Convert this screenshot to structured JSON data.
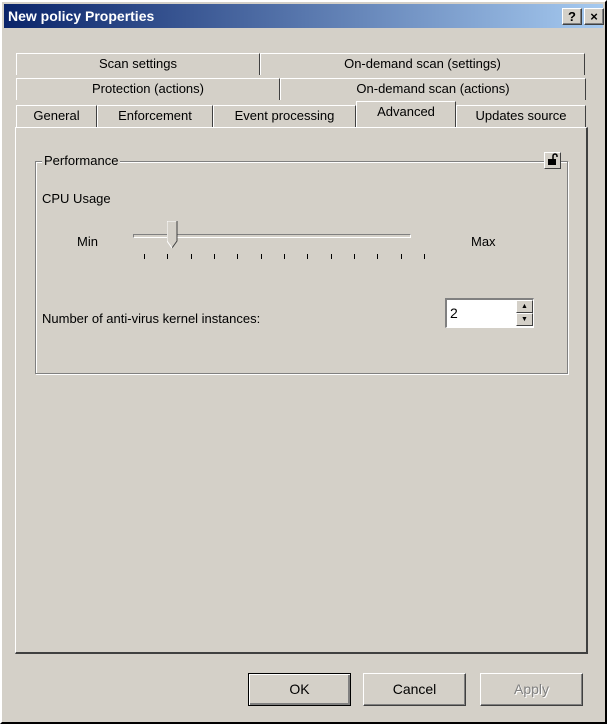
{
  "window": {
    "title": "New policy Properties",
    "help_glyph": "?",
    "close_glyph": "×"
  },
  "tabs": {
    "row1": [
      "Scan settings",
      "On-demand scan (settings)"
    ],
    "row2": [
      "Protection (actions)",
      "On-demand scan (actions)"
    ],
    "row3": [
      "General",
      "Enforcement",
      "Event processing",
      "Advanced",
      "Updates source"
    ],
    "active": "Advanced"
  },
  "performance": {
    "group_title": "Performance",
    "lock_icon": "lock-open-icon",
    "cpu_usage_label": "CPU Usage",
    "slider": {
      "min_label": "Min",
      "max_label": "Max",
      "value_fraction": 0.1
    },
    "kernel_label": "Number of anti-virus kernel instances:",
    "kernel_value": "2"
  },
  "buttons": {
    "ok": "OK",
    "cancel": "Cancel",
    "apply": "Apply"
  },
  "colors": {
    "face": "#d4d0c8",
    "title_start": "#0a246a",
    "title_end": "#a6caf0"
  }
}
